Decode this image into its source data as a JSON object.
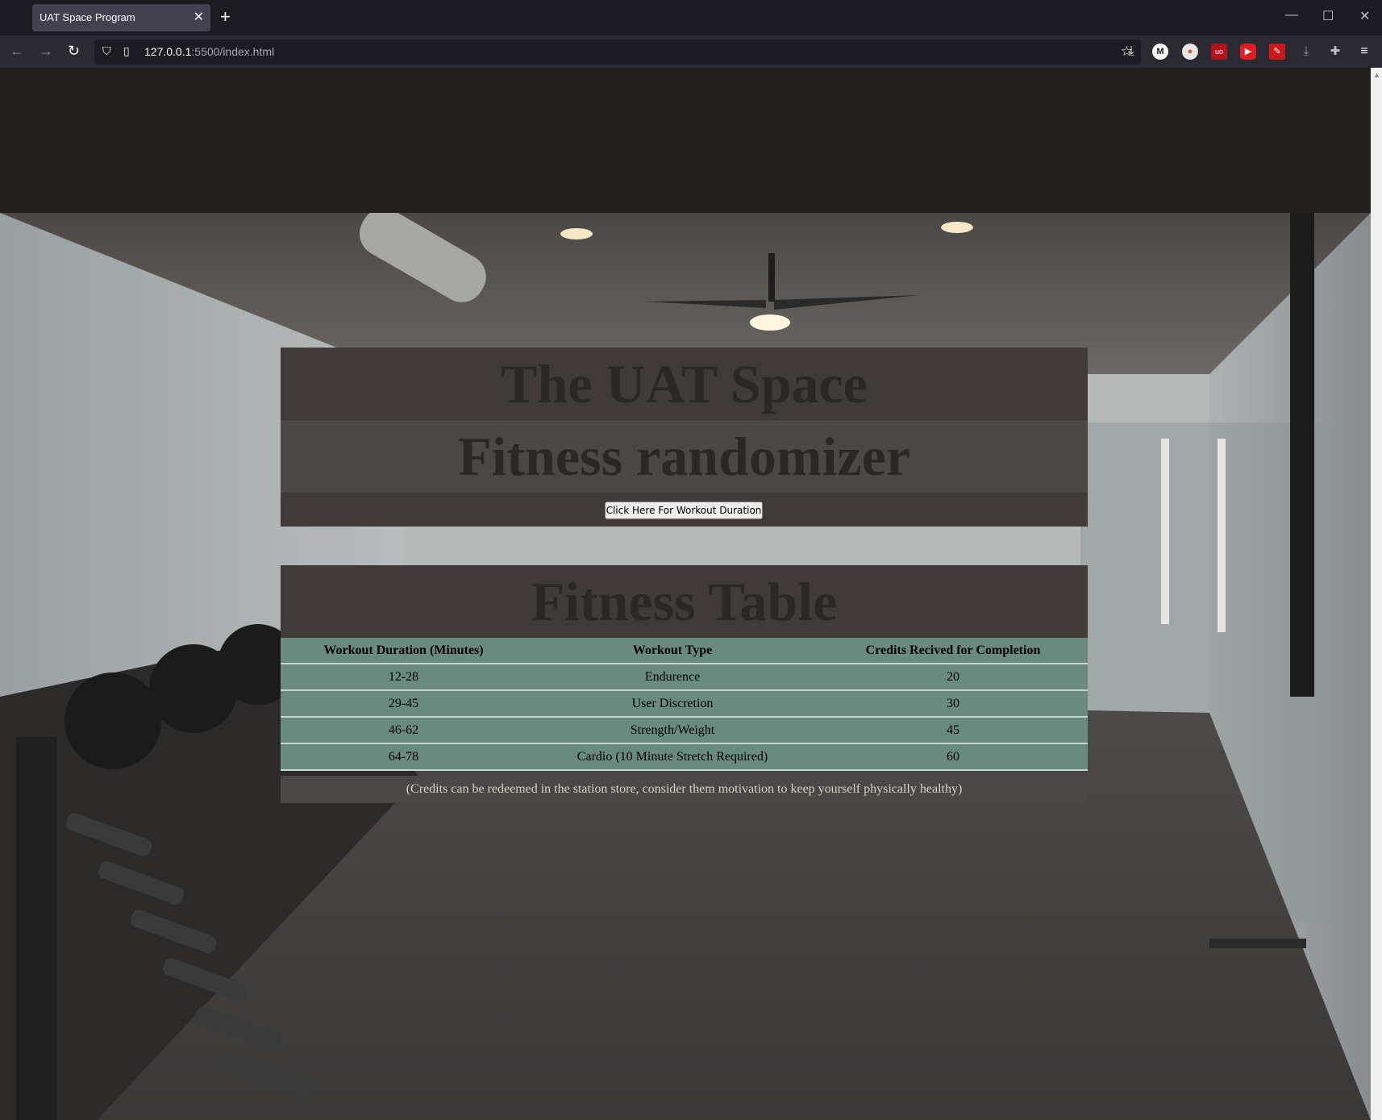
{
  "browser": {
    "tab_title": "UAT Space Program",
    "url_host": "127.0.0.1",
    "url_rest": ":5500/index.html"
  },
  "hero": {
    "title": "The UAT Space",
    "subtitle": "Fitness randomizer",
    "button_label": "Click Here For Workout Duration"
  },
  "fitness_table": {
    "title": "Fitness Table",
    "headers": [
      "Workout Duration (Minutes)",
      "Workout Type",
      "Credits Recived for Completion"
    ],
    "rows": [
      [
        "12-28",
        "Endurence",
        "20"
      ],
      [
        "29-45",
        "User Discretion",
        "30"
      ],
      [
        "46-62",
        "Strength/Weight",
        "45"
      ],
      [
        "64-78",
        "Cardio (10 Minute Stretch Required)",
        "60"
      ]
    ],
    "note": "(Credits can be redeemed in the station store, consider them motivation to keep yourself physically healthy)"
  }
}
